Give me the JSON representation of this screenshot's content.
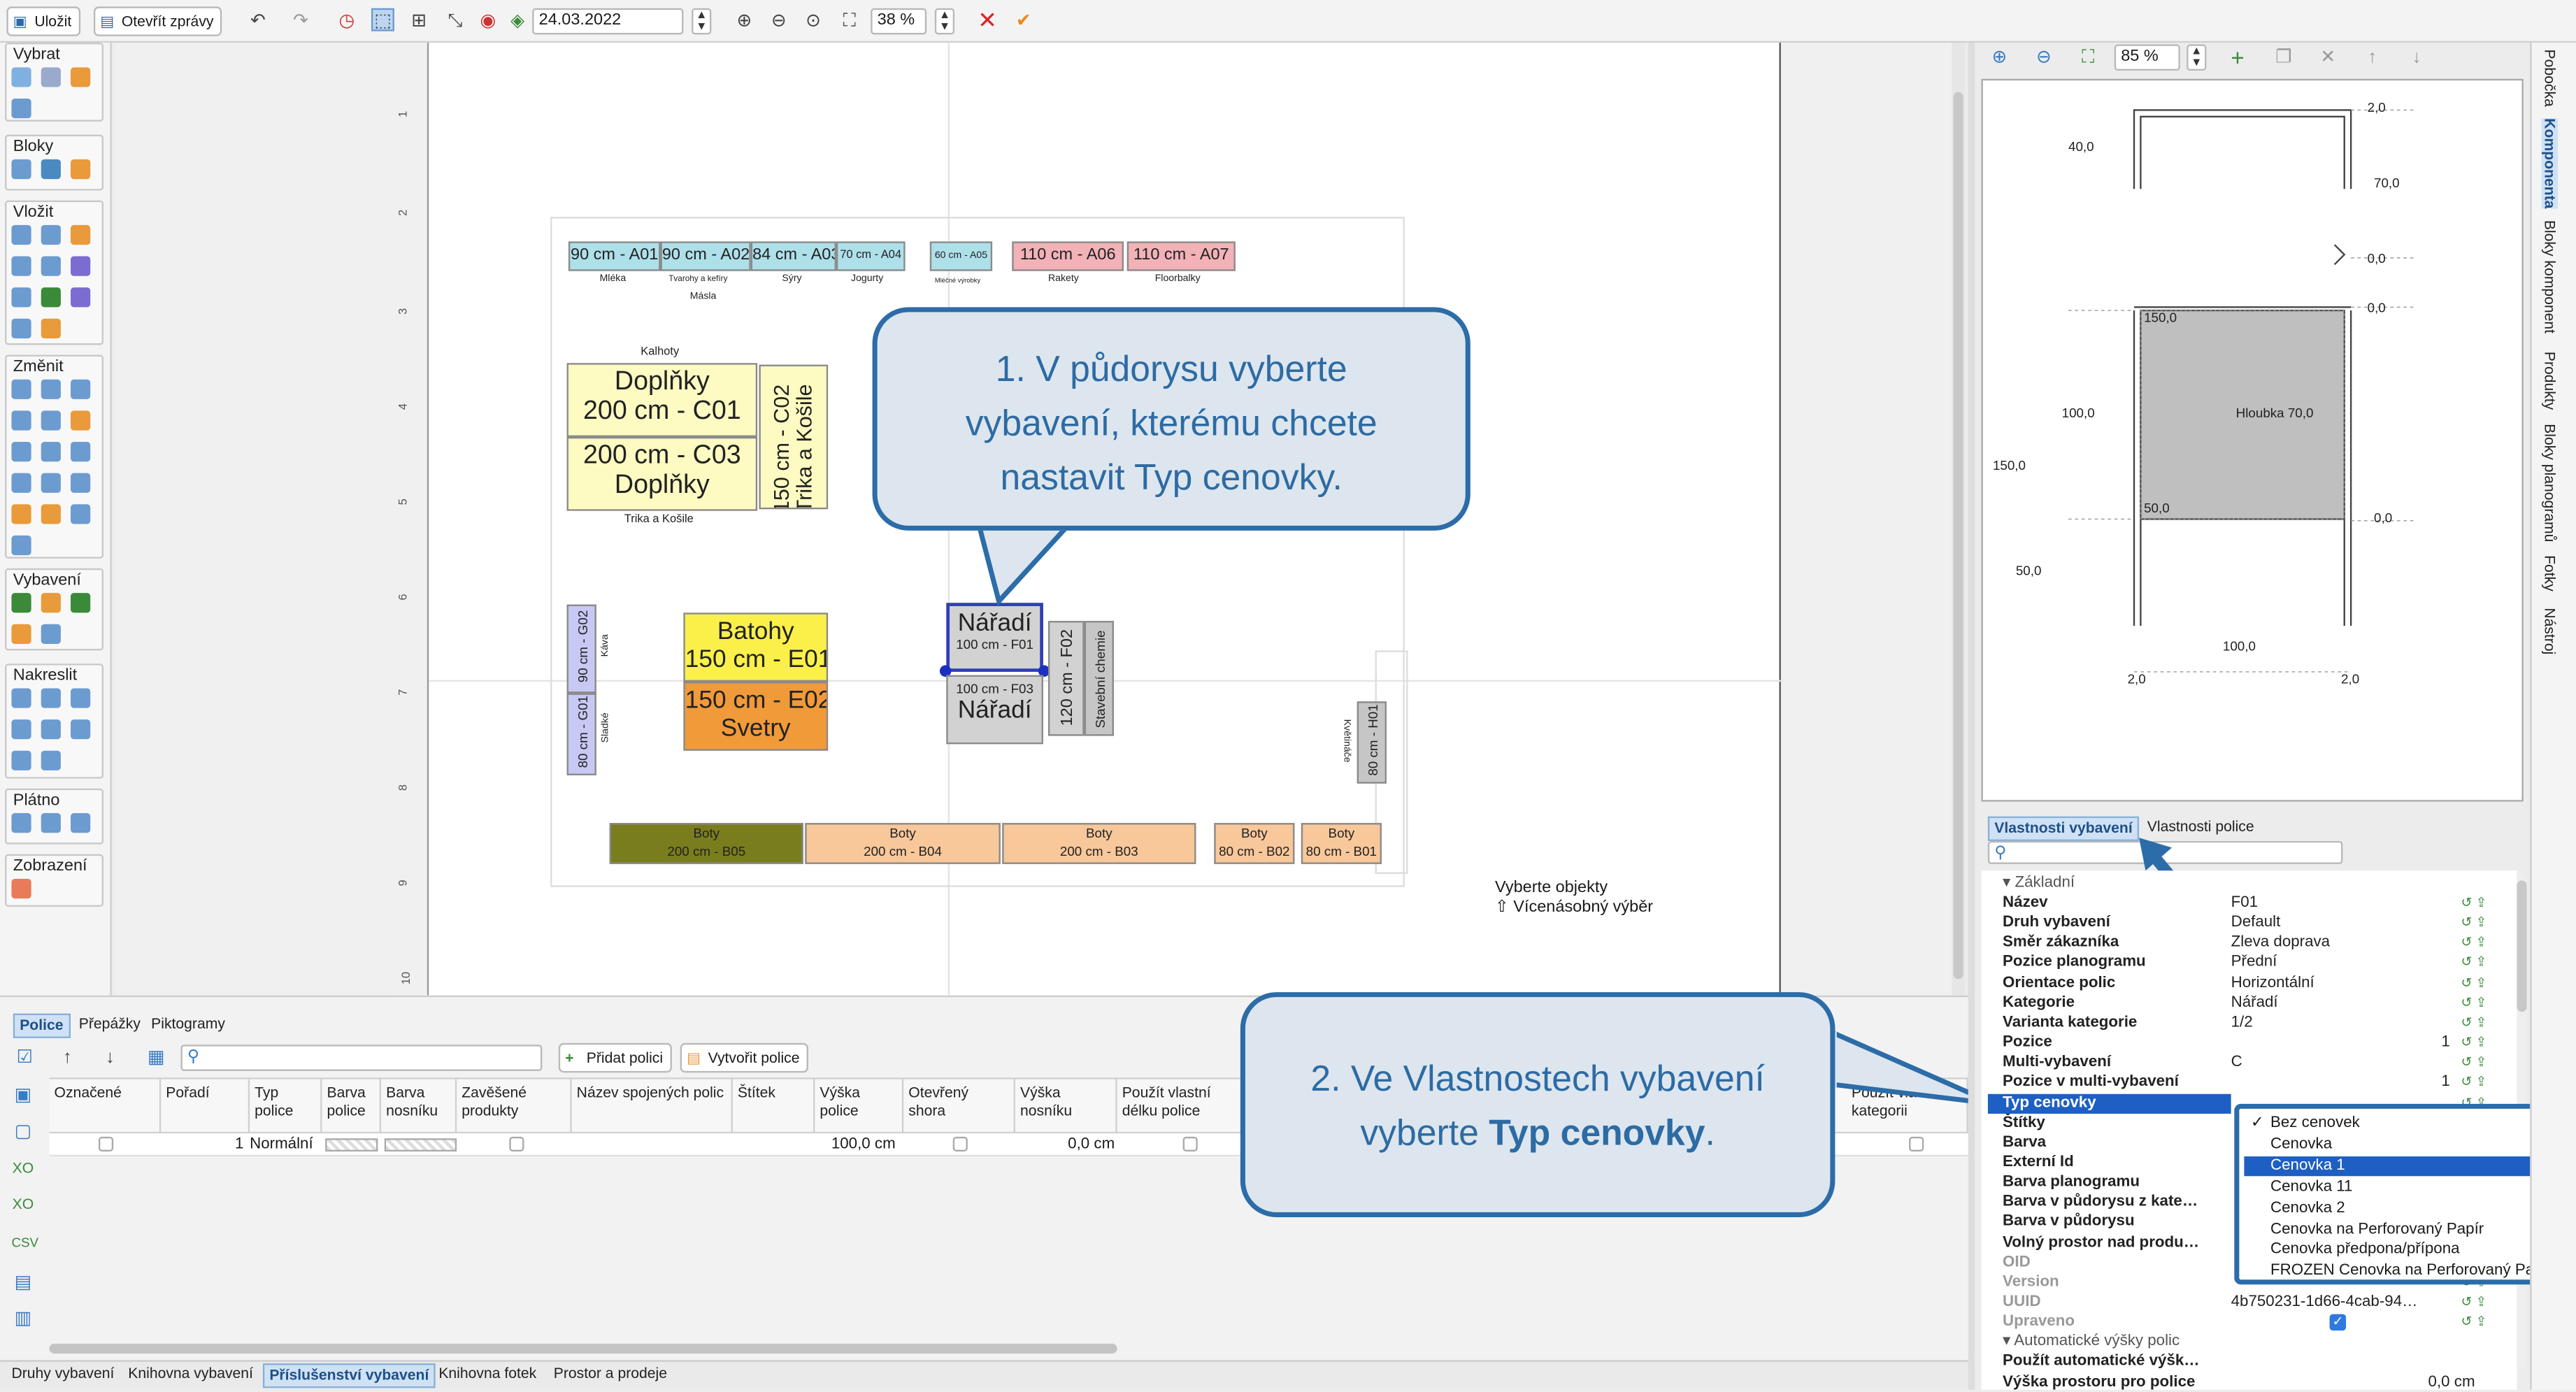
{
  "toolbar": {
    "save": "Uložit",
    "open_reports": "Otevřít zprávy",
    "date": "24.03.2022",
    "zoom": "38 %"
  },
  "left_panel": {
    "sections": [
      "Vybrat",
      "Bloky",
      "Vložit",
      "Změnit",
      "Vybavení",
      "Nakreslit",
      "Plátno",
      "Zobrazení"
    ]
  },
  "ruler": [
    "1",
    "2",
    "3",
    "4",
    "5",
    "6",
    "7",
    "8",
    "9",
    "10"
  ],
  "floor": {
    "top_row": [
      {
        "label": "90 cm - A01",
        "sub": "Mléka"
      },
      {
        "label": "90 cm - A02",
        "sub": "Tvarohy a kefíry"
      },
      {
        "label": "84 cm - A03",
        "sub": "Sýry"
      },
      {
        "label": "70 cm - A04",
        "sub": "Jogurty"
      },
      {
        "label": "60 cm - A05",
        "sub": "Mléčné výrobky"
      },
      {
        "label": "110 cm - A06",
        "sub": "Rakety"
      },
      {
        "label": "110 cm - A07",
        "sub": "Floorbalky"
      }
    ],
    "masla": "Másla",
    "kalhoty": "Kalhoty",
    "c01_a": "Doplňky",
    "c01_b": "200 cm - C01",
    "c03_a": "200 cm - C03",
    "c03_b": "Doplňky",
    "c02_a": "150 cm - C02",
    "c02_b": "Trika a Košile",
    "trika": "Trika a Košile",
    "g02": "90 cm - G02",
    "kava": "Káva",
    "g01": "80 cm - G01",
    "sladke": "Sladké",
    "e01_a": "Batohy",
    "e01_b": "150 cm - E01",
    "e02_a": "150 cm - E02",
    "e02_b": "Svetry",
    "f01_a": "Nářadí",
    "f01_b": "100 cm - F01",
    "f03_a": "100 cm - F03",
    "f03_b": "Nářadí",
    "f02": "120 cm - F02",
    "stav": "Stavební chemie",
    "h01": "80 cm - H01",
    "kvetinace": "Květináče",
    "boty": [
      {
        "a": "Boty",
        "b": "200 cm - B05"
      },
      {
        "a": "Boty",
        "b": "200 cm - B04"
      },
      {
        "a": "Boty",
        "b": "200 cm - B03"
      },
      {
        "a": "Boty",
        "b": "80 cm - B02"
      },
      {
        "a": "Boty",
        "b": "80 cm - B01"
      }
    ]
  },
  "status": {
    "line1": "Vyberte objekty",
    "line2": "Vícenásobný výběr"
  },
  "callout1": {
    "l1": "1. V půdorysu vyberte",
    "l2": "vybavení, kterému chcete",
    "l3": "nastavit Typ cenovky."
  },
  "callout2": {
    "l1": "2. Ve Vlastnostech vybavení",
    "l2a": "vyberte ",
    "l2b": "Typ cenovky",
    "l2c": "."
  },
  "right": {
    "zoom": "85 %",
    "vtabs": [
      "Pobočka",
      "Komponenta",
      "Bloky komponent",
      "Produkty",
      "Bloky planogramů",
      "Fotky",
      "Nástroj"
    ],
    "dims": [
      "2,0",
      "40,0",
      "70,0",
      "0,0",
      "0,0",
      "150,0",
      "100,0",
      "Hloubka 70,0",
      "150,0",
      "50,0",
      "0,0",
      "50,0",
      "100,0",
      "2,0",
      "2,0"
    ],
    "tabs": [
      "Vlastnosti vybavení",
      "Vlastnosti police"
    ],
    "group_basic": "Základní",
    "group_auto": "Automatické výšky polic",
    "props": [
      [
        "Název",
        "F01"
      ],
      [
        "Druh vybavení",
        "Default"
      ],
      [
        "Směr zákazníka",
        "Zleva doprava"
      ],
      [
        "Pozice planogramu",
        "Přední"
      ],
      [
        "Orientace polic",
        "Horizontální"
      ],
      [
        "Kategorie",
        "Nářadí"
      ],
      [
        "Varianta kategorie",
        "1/2"
      ],
      [
        "Pozice",
        "1"
      ],
      [
        "Multi-vybavení",
        "C"
      ],
      [
        "Pozice v multi-vybavení",
        "1"
      ],
      [
        "Typ cenovky",
        ""
      ],
      [
        "Štítky",
        ""
      ],
      [
        "Barva",
        ""
      ],
      [
        "Externí Id",
        ""
      ],
      [
        "Barva planogramu",
        ""
      ],
      [
        "Barva v půdorysu z kate…",
        ""
      ],
      [
        "Barva v půdorysu",
        ""
      ],
      [
        "Volný prostor nad produ…",
        ""
      ],
      [
        "OID",
        ""
      ],
      [
        "Version",
        ""
      ],
      [
        "UUID",
        "4b750231-1d66-4cab-94…"
      ],
      [
        "Upraveno",
        ""
      ]
    ],
    "props2": [
      [
        "Použít automatické výšk…",
        ""
      ],
      [
        "Výška prostoru pro police",
        "0,0 cm"
      ]
    ],
    "dropdown": [
      "Bez cenovek",
      "Cenovka",
      "Cenovka 1",
      "Cenovka 11",
      "Cenovka 2",
      "Cenovka na Perforovaný Papír",
      "Cenovka předpona/přípona",
      "FROZEN Cenovka na Perforovaný Papír"
    ]
  },
  "bottom": {
    "tabs": [
      "Police",
      "Přepážky",
      "Piktogramy"
    ],
    "add": "Přidat polici",
    "create": "Vytvořit police",
    "cols": [
      "Označené",
      "Pořadí",
      "Typ police",
      "Barva police",
      "Barva nosníku",
      "Zavěšené produkty",
      "Název spojených polic",
      "Štítek",
      "Výška police",
      "Otevřený shora",
      "Výška nosníku",
      "Použít vlastní délku police",
      "Použít vlastní kategorii"
    ],
    "row": {
      "order": "1",
      "type": "Normální",
      "height": "100,0 cm",
      "beam": "0,0 cm"
    },
    "bottom_tabs": [
      "Druhy vybavení",
      "Knihovna vybavení",
      "Příslušenství vybavení",
      "Knihovna fotek",
      "Prostor a prodeje"
    ]
  }
}
